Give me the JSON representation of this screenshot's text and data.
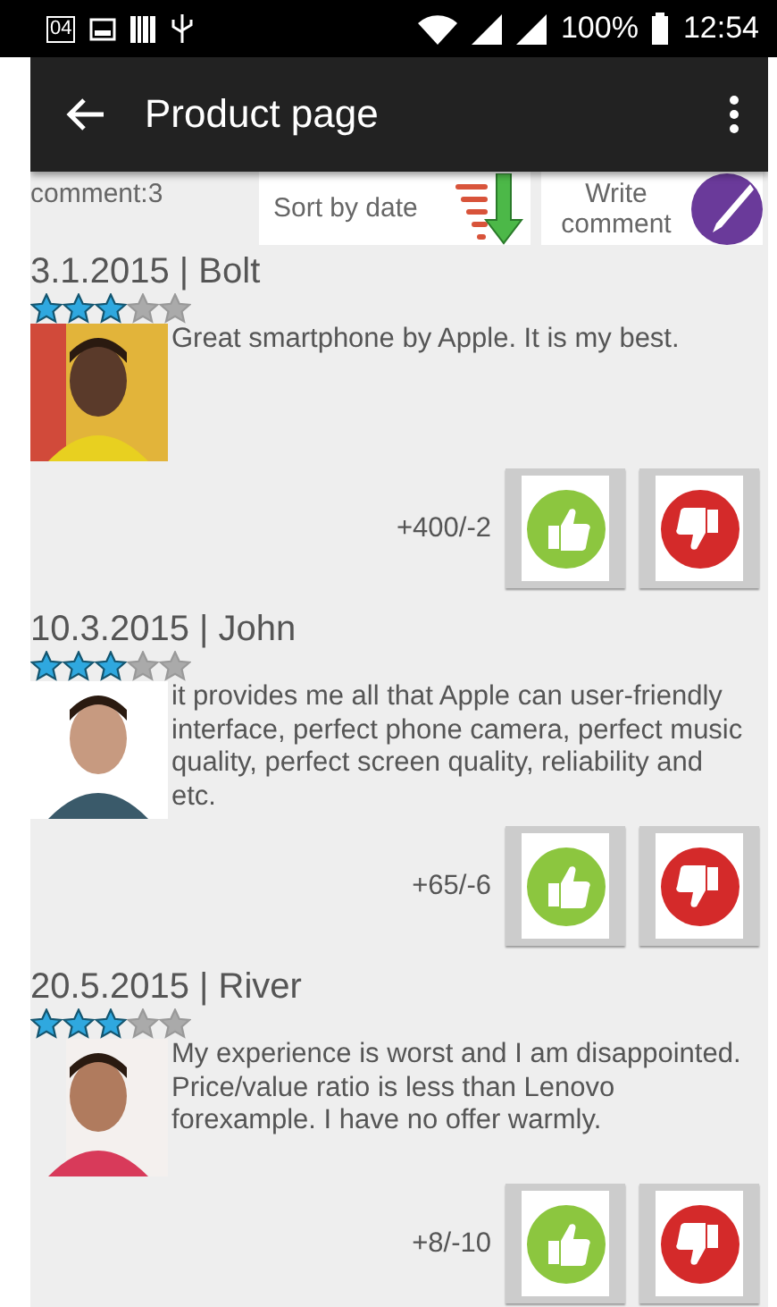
{
  "status_bar": {
    "battery": "100%",
    "time": "12:54",
    "notification": "04"
  },
  "app_bar": {
    "title": "Product page"
  },
  "toolbar": {
    "count": "comment:3",
    "sort": "Sort by date",
    "write": "Write comment"
  },
  "comments": [
    {
      "heading": "3.1.2015 | Bolt",
      "stars": 3,
      "text": "Great smartphone by Apple. It is my best.",
      "votes": "+400/-2"
    },
    {
      "heading": "10.3.2015 | John",
      "stars": 3,
      "text": "it provides me all that Apple can user-friendly interface, perfect phone camera, perfect music quality, perfect screen quality, reliability and etc.",
      "votes": "+65/-6"
    },
    {
      "heading": "20.5.2015 | River",
      "stars": 3,
      "text": "My experience is worst and I am disappointed. Price/value ratio is less than Lenovo forexample. I have no offer warmly.",
      "votes": "+8/-10"
    }
  ]
}
